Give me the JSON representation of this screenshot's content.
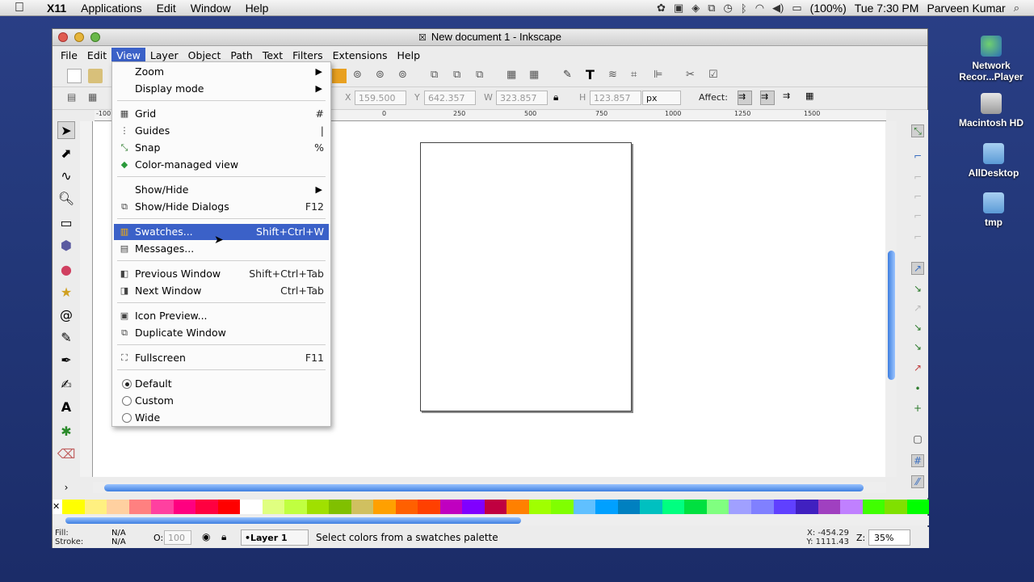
{
  "mac_menubar": {
    "app": "X11",
    "items": [
      "Applications",
      "Edit",
      "Window",
      "Help"
    ],
    "battery": "(100%)",
    "clock": "Tue 7:30 PM",
    "user": "Parveen Kumar"
  },
  "desktop": {
    "icons": [
      {
        "label": "Network Recor...Player"
      },
      {
        "label": "Macintosh HD"
      },
      {
        "label": "AllDesktop"
      },
      {
        "label": "tmp"
      }
    ]
  },
  "window": {
    "title": "New document 1 - Inkscape",
    "menu": [
      "File",
      "Edit",
      "View",
      "Layer",
      "Object",
      "Path",
      "Text",
      "Filters",
      "Extensions",
      "Help"
    ],
    "active_menu": "View"
  },
  "controls": {
    "x_label": "X",
    "x_value": "159.500",
    "y_label": "Y",
    "y_value": "642.357",
    "w_label": "W",
    "w_value": "323.857",
    "h_label": "H",
    "h_value": "123.857",
    "unit": "px",
    "affect_label": "Affect:"
  },
  "ruler": {
    "ticks": [
      "-100",
      "0",
      "250",
      "500",
      "750",
      "1000",
      "1250",
      "1500"
    ]
  },
  "view_menu": {
    "items": [
      {
        "label": "Zoom",
        "shortcut": "",
        "submenu": true
      },
      {
        "label": "Display mode",
        "shortcut": "",
        "submenu": true
      },
      {
        "label": "Grid",
        "shortcut": "#"
      },
      {
        "label": "Guides",
        "shortcut": "|"
      },
      {
        "label": "Snap",
        "shortcut": "%"
      },
      {
        "label": "Color-managed view",
        "shortcut": ""
      },
      {
        "label": "Show/Hide",
        "shortcut": "",
        "submenu": true
      },
      {
        "label": "Show/Hide Dialogs",
        "shortcut": "F12"
      },
      {
        "label": "Swatches...",
        "shortcut": "Shift+Ctrl+W"
      },
      {
        "label": "Messages...",
        "shortcut": ""
      },
      {
        "label": "Previous Window",
        "shortcut": "Shift+Ctrl+Tab"
      },
      {
        "label": "Next Window",
        "shortcut": "Ctrl+Tab"
      },
      {
        "label": "Icon Preview...",
        "shortcut": ""
      },
      {
        "label": "Duplicate Window",
        "shortcut": ""
      },
      {
        "label": "Fullscreen",
        "shortcut": "F11"
      },
      {
        "label": "Default",
        "shortcut": ""
      },
      {
        "label": "Custom",
        "shortcut": ""
      },
      {
        "label": "Wide",
        "shortcut": ""
      }
    ],
    "highlighted": "Swatches...",
    "selected_mode": "Default"
  },
  "statusbar": {
    "fill_label": "Fill:",
    "fill_value": "N/A",
    "stroke_label": "Stroke:",
    "stroke_value": "N/A",
    "opacity_label": "O:",
    "opacity_value": "100",
    "layer": "•Layer 1",
    "message": "Select colors from a swatches palette",
    "x_coord": "X: -454.29",
    "y_coord": "Y: 1111.43",
    "zoom_label": "Z:",
    "zoom": "35%"
  },
  "palette_colors": [
    "#ffff00",
    "#fff080",
    "#ffd0a0",
    "#ff8080",
    "#ff40a0",
    "#ff0080",
    "#ff0040",
    "#ff0000",
    "#ffffff",
    "#e0ff80",
    "#c0ff40",
    "#a0e000",
    "#80c000",
    "#d0c060",
    "#ffa000",
    "#ff6000",
    "#ff4000",
    "#c000c0",
    "#8000ff",
    "#c00040",
    "#ff8000",
    "#a0ff00",
    "#80ff00",
    "#60c0ff",
    "#00a0ff",
    "#0080c0",
    "#00c0c0",
    "#00ff80",
    "#00e040",
    "#80ff80",
    "#a0a0ff",
    "#8080ff",
    "#6040ff",
    "#4020c0",
    "#a040c0",
    "#c080ff",
    "#40ff00",
    "#80e000",
    "#00ff00"
  ]
}
